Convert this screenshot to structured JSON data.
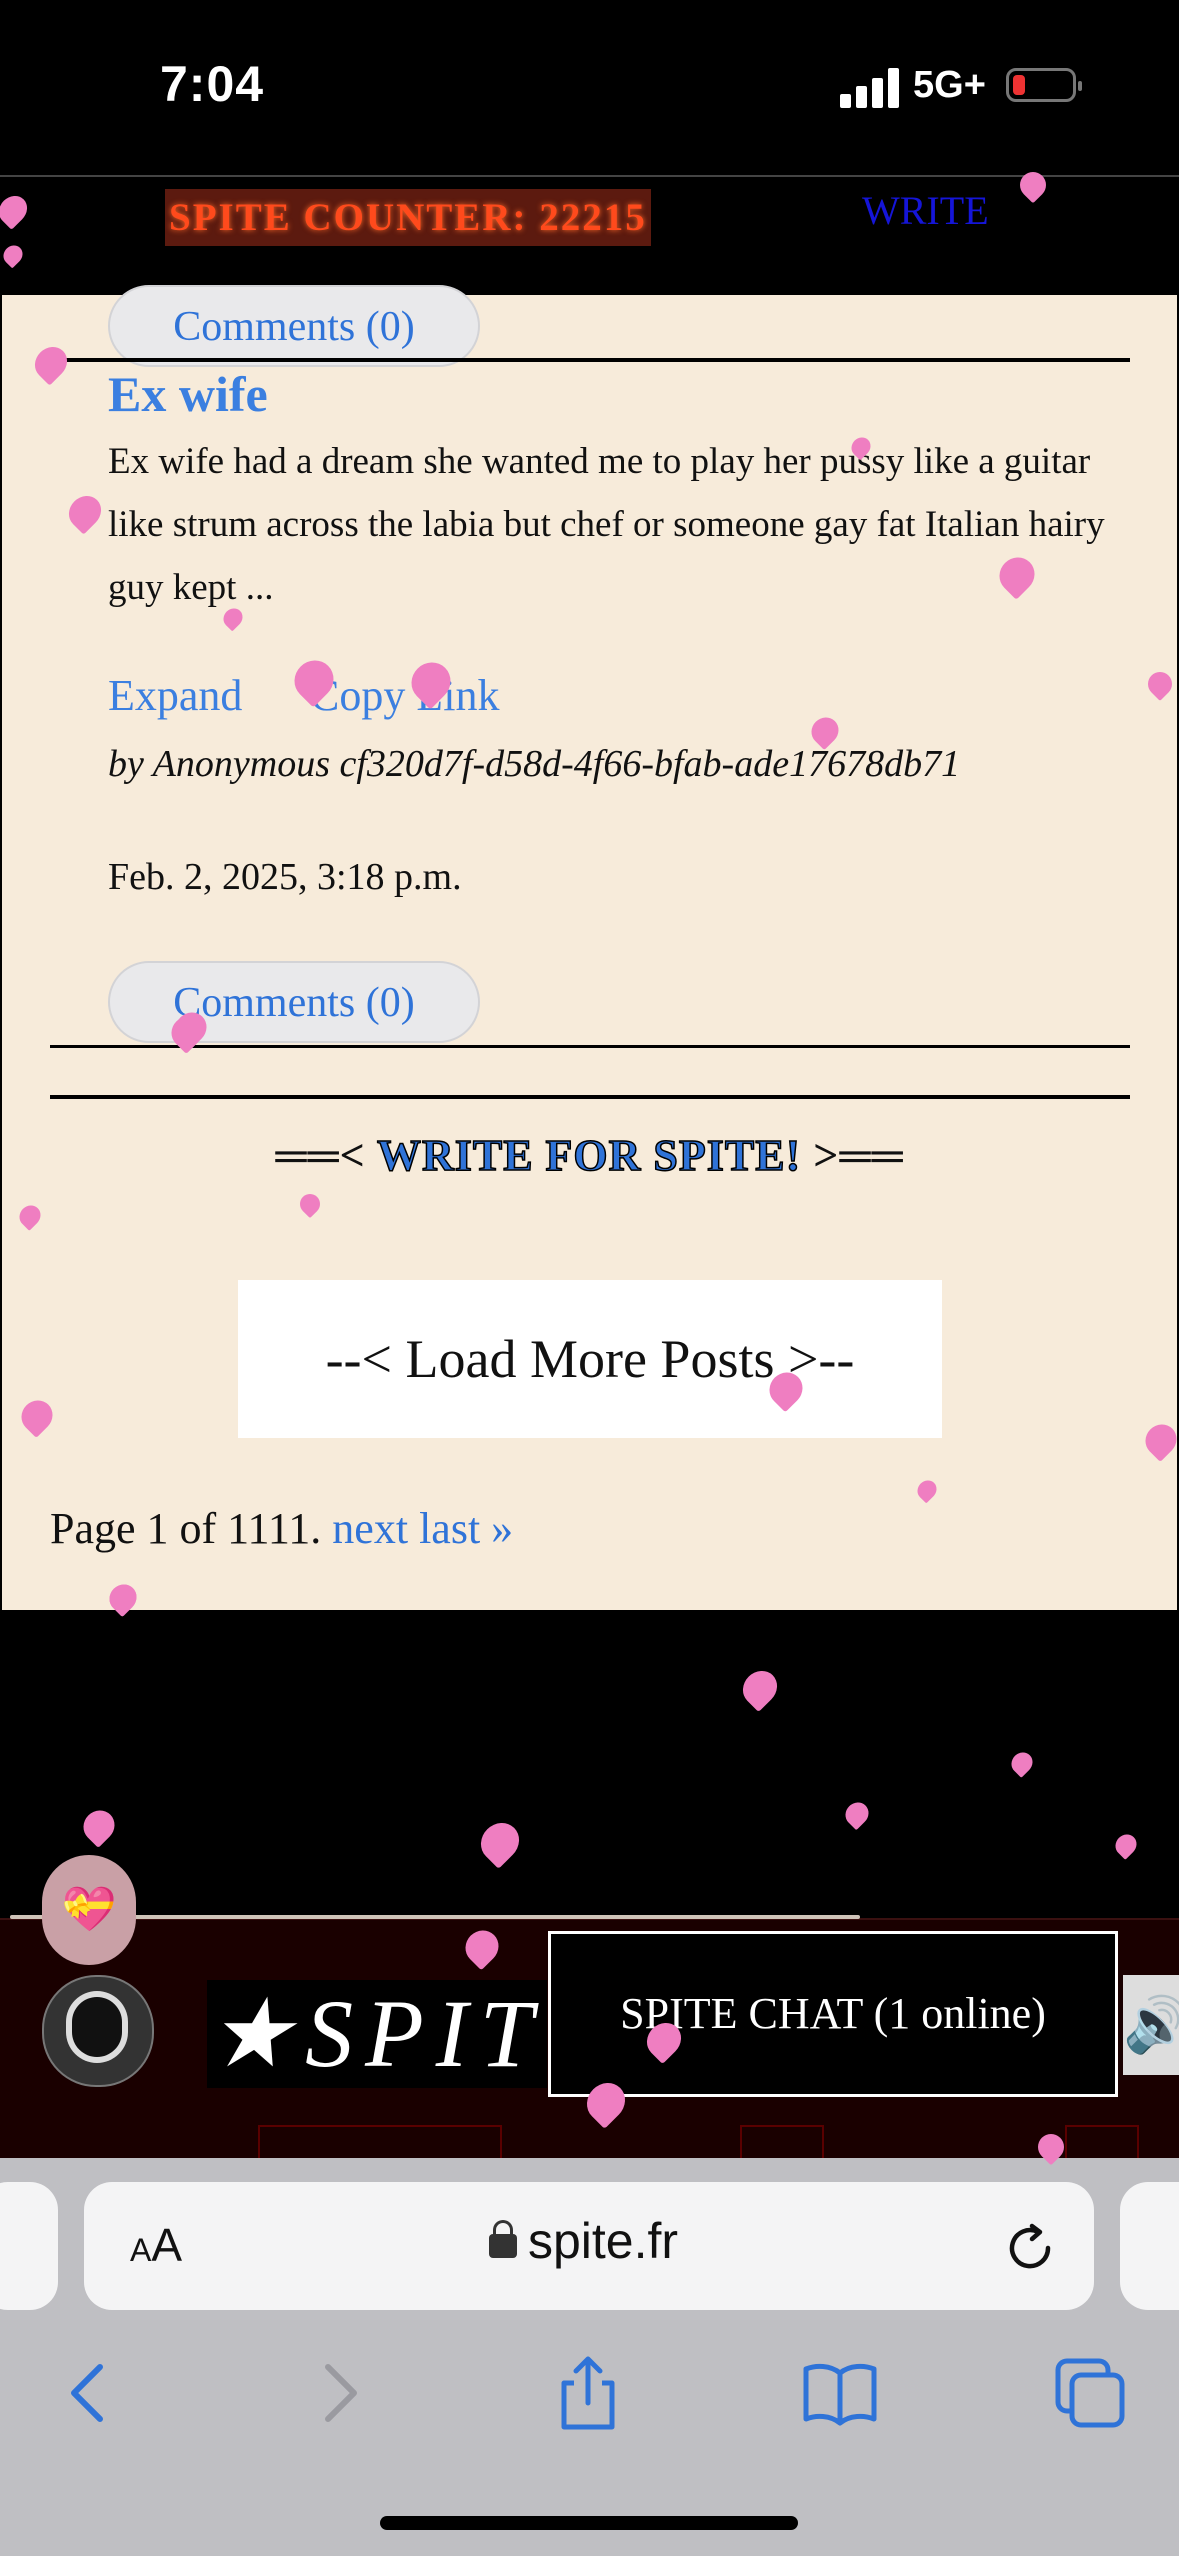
{
  "status_bar": {
    "time": "7:04",
    "network": "5G+"
  },
  "top_nav": {
    "spite_counter": "SPITE COUNTER: 22215",
    "write_link": "WRITE"
  },
  "previous_post": {
    "comments_label": "Comments (0)"
  },
  "post": {
    "title": "Ex wife",
    "body": "Ex wife had a dream she wanted me to play her pussy like a guitar like strum across the labia but chef or someone gay fat Italian hairy guy kept ...",
    "expand_label": "Expand",
    "copy_link_label": "Copy Link",
    "byline": "by Anonymous cf320d7f-d58d-4f66-bfab-ade17678db71",
    "date": "Feb. 2, 2025, 3:18 p.m.",
    "comments_label": "Comments (0)"
  },
  "write_for_spite": {
    "left_deco": "══<",
    "label": "WRITE FOR SPITE!",
    "right_deco": ">══"
  },
  "load_more": {
    "label": "--< Load More Posts >--"
  },
  "pagination": {
    "text": "Page 1 of 1111.",
    "next_label": "next",
    "last_label": "last »"
  },
  "chat_bar": {
    "emoji": "💝",
    "logo_text": "★SPIT",
    "chat_button": "SPITE CHAT (1 online)",
    "speaker_icon": "🔊"
  },
  "browser": {
    "text_size_small": "A",
    "text_size_large": "A",
    "url": "spite.fr"
  },
  "colors": {
    "accent_blue": "#3b7fe0",
    "content_bg": "#f7ebda",
    "counter_text": "#ff4a1c",
    "heart": "#ef7ec1"
  }
}
